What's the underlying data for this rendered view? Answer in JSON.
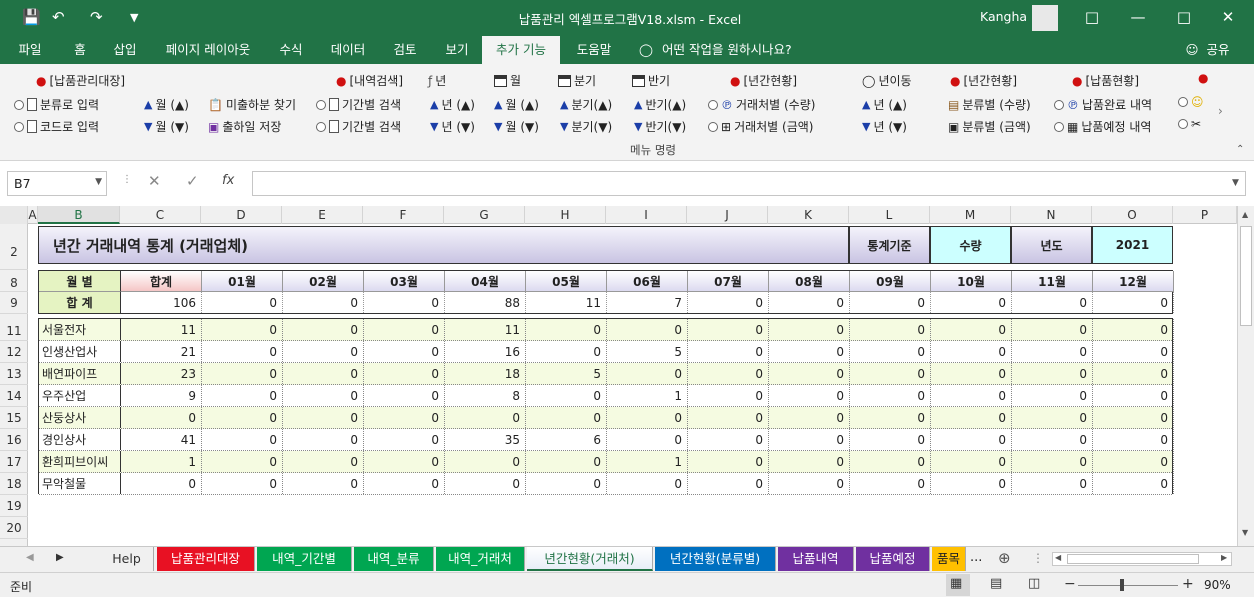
{
  "window": {
    "title": "납품관리 엑셀프로그램V18.xlsm  -  Excel",
    "user": "Kangha",
    "share_label": "공유"
  },
  "tabs": [
    "파일",
    "홈",
    "삽입",
    "페이지 레이아웃",
    "수식",
    "데이터",
    "검토",
    "보기",
    "추가 기능",
    "도움말"
  ],
  "active_tab": "추가 기능",
  "tell_me": "어떤 작업을 원하시나요?",
  "ribbon": {
    "g1_title": "[납품관리대장]",
    "g1_b1": "분류로 입력",
    "g1_b2": "코드로 입력",
    "g1_b3": "월 (▲)",
    "g1_b4": "월 (▼)",
    "g1_b5": "미출하분 찾기",
    "g1_b6": "출하일 저장",
    "g2_title": "[내역검색]",
    "g2_b1": "기간별 검색",
    "g2_b2": "기간별 검색",
    "g2_year": "년",
    "g2_month": "월",
    "g2_quarter": "분기",
    "g2_half": "반기",
    "g2_b3": "년 (▲)",
    "g2_b4": "년 (▼)",
    "g2_b5": "월 (▲)",
    "g2_b6": "월 (▼)",
    "g2_b7": "분기(▲)",
    "g2_b8": "분기(▼)",
    "g2_b9": "반기(▲)",
    "g2_b10": "반기(▼)",
    "g3_title": "[년간현황]",
    "g3_b1": "거래처별 (수량)",
    "g3_b2": "거래처별 (금액)",
    "g3_move": "년이동",
    "g3_b3": "년 (▲)",
    "g3_b4": "년 (▼)",
    "g4_title": "[년간현황]",
    "g4_b1": "분류별 (수량)",
    "g4_b2": "분류별 (금액)",
    "g5_title": "[납품현황]",
    "g5_b1": "납품완료 내역",
    "g5_b2": "납품예정 내역",
    "caption": "메뉴 명령"
  },
  "formula_bar": {
    "name_box": "B7",
    "fx": "fx",
    "value": ""
  },
  "columns": [
    "A",
    "B",
    "C",
    "D",
    "E",
    "F",
    "G",
    "H",
    "I",
    "J",
    "K",
    "L",
    "M",
    "N",
    "O",
    "P"
  ],
  "rows": [
    "2",
    "8",
    "9",
    "11",
    "12",
    "13",
    "14",
    "15",
    "16",
    "17",
    "18",
    "19",
    "20"
  ],
  "sheet": {
    "title": "년간 거래내역 통계 (거래업체)",
    "basis_label": "통계기준",
    "basis_value": "수량",
    "year_label": "년도",
    "year_value": "2021",
    "month_label": "월   별",
    "sum_label": "합   계",
    "total_header": "합계",
    "months": [
      "01월",
      "02월",
      "03월",
      "04월",
      "05월",
      "06월",
      "07월",
      "08월",
      "09월",
      "10월",
      "11월",
      "12월"
    ],
    "totals": [
      "106",
      "0",
      "0",
      "0",
      "88",
      "11",
      "7",
      "0",
      "0",
      "0",
      "0",
      "0",
      "0"
    ],
    "rows": [
      {
        "name": "서울전자",
        "values": [
          "11",
          "0",
          "0",
          "0",
          "11",
          "0",
          "0",
          "0",
          "0",
          "0",
          "0",
          "0",
          "0"
        ]
      },
      {
        "name": "인생산업사",
        "values": [
          "21",
          "0",
          "0",
          "0",
          "16",
          "0",
          "5",
          "0",
          "0",
          "0",
          "0",
          "0",
          "0"
        ]
      },
      {
        "name": "배연파이프",
        "values": [
          "23",
          "0",
          "0",
          "0",
          "18",
          "5",
          "0",
          "0",
          "0",
          "0",
          "0",
          "0",
          "0"
        ]
      },
      {
        "name": "우주산업",
        "values": [
          "9",
          "0",
          "0",
          "0",
          "8",
          "0",
          "1",
          "0",
          "0",
          "0",
          "0",
          "0",
          "0"
        ]
      },
      {
        "name": "산둥상사",
        "values": [
          "0",
          "0",
          "0",
          "0",
          "0",
          "0",
          "0",
          "0",
          "0",
          "0",
          "0",
          "0",
          "0"
        ]
      },
      {
        "name": "경인상사",
        "values": [
          "41",
          "0",
          "0",
          "0",
          "35",
          "6",
          "0",
          "0",
          "0",
          "0",
          "0",
          "0",
          "0"
        ]
      },
      {
        "name": "환희피브이씨",
        "values": [
          "1",
          "0",
          "0",
          "0",
          "0",
          "0",
          "1",
          "0",
          "0",
          "0",
          "0",
          "0",
          "0"
        ]
      },
      {
        "name": "무악철물",
        "values": [
          "0",
          "0",
          "0",
          "0",
          "0",
          "0",
          "0",
          "0",
          "0",
          "0",
          "0",
          "0",
          "0"
        ]
      }
    ]
  },
  "sheet_tabs": [
    {
      "label": "Help",
      "color": "#f0f0f0"
    },
    {
      "label": "납품관리대장",
      "color": "#e81123"
    },
    {
      "label": "내역_기간별",
      "color": "#00a651"
    },
    {
      "label": "내역_분류",
      "color": "#00a651"
    },
    {
      "label": "내역_거래처",
      "color": "#00a651"
    },
    {
      "label": "년간현황(거래처)",
      "color": "#ffffff"
    },
    {
      "label": "년간현황(분류별)",
      "color": "#0070c0"
    },
    {
      "label": "납품내역",
      "color": "#7030a0"
    },
    {
      "label": "납품예정",
      "color": "#7030a0"
    },
    {
      "label": "품목",
      "color": "#ffc000"
    }
  ],
  "sheet_more": "...",
  "status": {
    "ready": "준비",
    "zoom": "90%",
    "minus": "−",
    "plus": "+"
  },
  "colors": {
    "excel_green": "#217346",
    "row_alt": "#f5fbe1",
    "header_lavender": "#dcdaf0"
  }
}
